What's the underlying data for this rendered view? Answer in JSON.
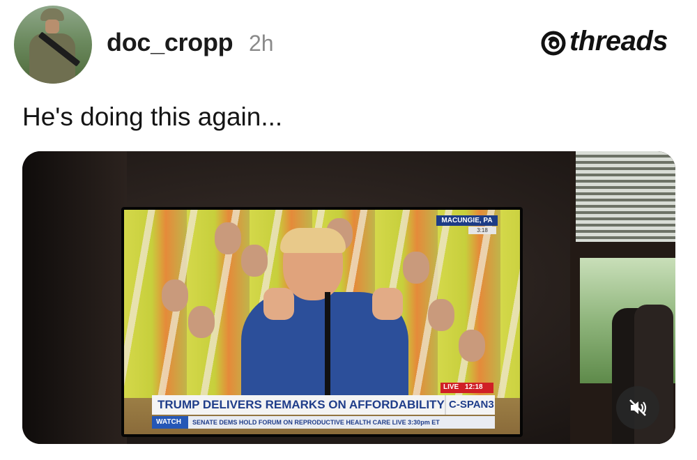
{
  "post": {
    "username": "doc_cropp",
    "timestamp": "2h",
    "caption": "He's doing this again..."
  },
  "brand": {
    "name": "threads",
    "icon": "threads-logo-icon"
  },
  "media": {
    "type": "video",
    "tv_screen": {
      "location": "MACUNGIE, PA",
      "local_time": "3:18",
      "live_label": "LIVE",
      "live_time": "12:18",
      "headline": "TRUMP DELIVERS REMARKS ON AFFORDABILITY",
      "network": "C-SPAN3",
      "ticker_label": "WATCH",
      "ticker_text": "SENATE DEMS HOLD FORUM ON REPRODUCTIVE HEALTH CARE  LIVE 3:30pm ET"
    },
    "controls": {
      "mute_icon": "muted-speaker-icon"
    }
  }
}
